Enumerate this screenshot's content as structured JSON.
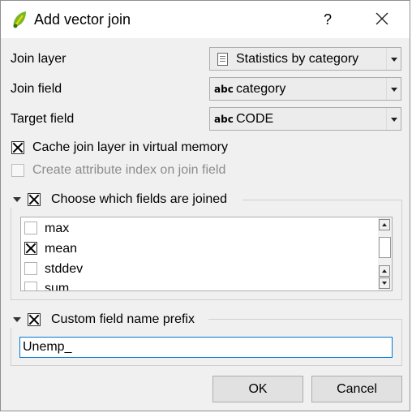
{
  "window": {
    "title": "Add vector join",
    "help_label": "?"
  },
  "form": {
    "join_layer_label": "Join layer",
    "join_layer_value": "Statistics by category",
    "join_field_label": "Join field",
    "join_field_value": "category",
    "target_field_label": "Target field",
    "target_field_value": "CODE",
    "field_type_badge": "abc",
    "cache_label": "Cache join layer in virtual memory",
    "cache_checked": true,
    "index_label": "Create attribute index on join field",
    "index_checked": false
  },
  "fields_group": {
    "title": "Choose which fields are joined",
    "checked": true,
    "items": [
      {
        "label": "max",
        "checked": false
      },
      {
        "label": "mean",
        "checked": true
      },
      {
        "label": "stddev",
        "checked": false
      },
      {
        "label": "sum",
        "checked": false
      }
    ]
  },
  "prefix_group": {
    "title": "Custom field name prefix",
    "checked": true,
    "value": "Unemp_"
  },
  "buttons": {
    "ok": "OK",
    "cancel": "Cancel"
  },
  "icons": {
    "app": "qgis-icon",
    "layer": "table-layer-icon",
    "colors": {
      "qgis_green": "#77b82a",
      "focus_border": "#0078d7"
    }
  }
}
